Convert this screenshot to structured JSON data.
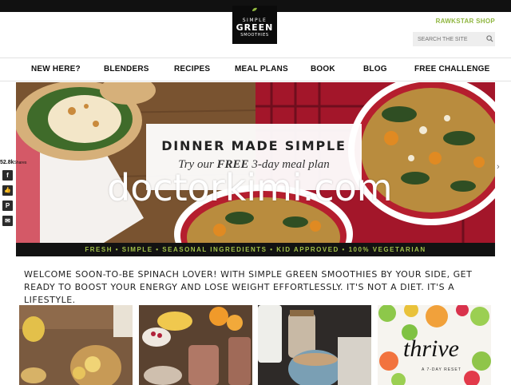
{
  "header": {
    "logo": {
      "line1": "SIMPLE",
      "line2": "GREEN",
      "line3": "SMOOTHIES"
    },
    "shop_link": "RAWKSTAR SHOP",
    "search_placeholder": "SEARCH THE SITE"
  },
  "nav": {
    "items": [
      {
        "label": "NEW HERE?"
      },
      {
        "label": "BLENDERS"
      },
      {
        "label": "RECIPES"
      },
      {
        "label": "MEAL PLANS"
      },
      {
        "label": "BOOK"
      },
      {
        "label": "BLOG"
      },
      {
        "label": "FREE CHALLENGE"
      }
    ]
  },
  "hero": {
    "title": "DINNER MADE SIMPLE",
    "subtitle_pre": "Try our ",
    "subtitle_bold": "FREE",
    "subtitle_post": " 3-day meal plan",
    "strip": "FRESH  •  SIMPLE  •  SEASONAL INGREDIENTS  •  KID APPROVED  •  100% VEGETARIAN"
  },
  "watermark": "doctorkimi.com",
  "share": {
    "count": "52.8k",
    "count_label": "Shares",
    "buttons": [
      "f",
      "👍",
      "P",
      "✉"
    ]
  },
  "welcome": "WELCOME SOON-TO-BE SPINACH LOVER! WITH SIMPLE GREEN SMOOTHIES BY YOUR SIDE, GET READY TO BOOST YOUR ENERGY AND LOSE WEIGHT EFFORTLESSLY. IT'S NOT A DIET. IT'S A LIFESTYLE.",
  "thumbs": {
    "thrive_title": "thrive",
    "thrive_sub": "A 7-DAY RESET"
  },
  "colors": {
    "accent_green": "#8fb63f",
    "strip_green": "#a2c249",
    "dark": "#111111"
  }
}
